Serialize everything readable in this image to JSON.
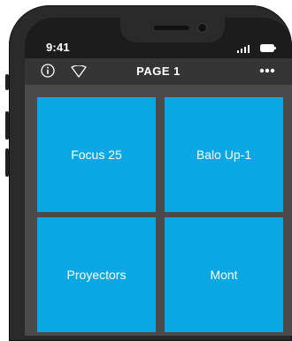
{
  "status_bar": {
    "time": "9:41",
    "icons": [
      "signal-icon",
      "battery-icon"
    ]
  },
  "nav_bar": {
    "title": "PAGE 1",
    "icons": [
      "info-icon",
      "wifi-icon",
      "more-icon"
    ]
  },
  "tiles": [
    {
      "label": "Focus 25"
    },
    {
      "label": "Balo Up-1"
    },
    {
      "label": "Proyectors"
    },
    {
      "label": "Mont"
    }
  ],
  "colors": {
    "tile": "#09a8e5",
    "screen_bg": "#4a4a4a",
    "nav_bg": "#353535",
    "status_bg": "#1c1c1c"
  }
}
